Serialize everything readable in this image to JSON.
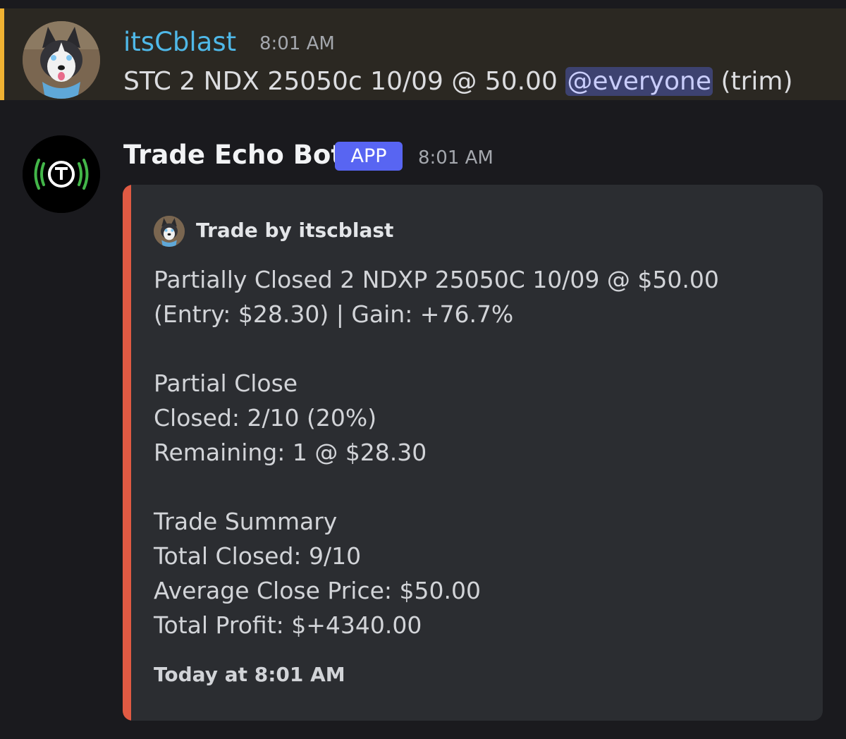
{
  "messages": [
    {
      "author": "itsCblast",
      "timestamp": "8:01 AM",
      "content_prefix": "STC 2 NDX 25050c 10/09 @ 50.00 ",
      "mention": "@everyone",
      "content_suffix": " (trim)",
      "avatar_icon": "husky-avatar-icon",
      "highlight_color": "#f0b232"
    },
    {
      "author": "Trade Echo Bot",
      "badge": "APP",
      "timestamp": "8:01 AM",
      "avatar_icon": "trade-echo-logo-icon",
      "embed": {
        "accent_color": "#e05a43",
        "author_name": "Trade by itscblast",
        "author_icon": "husky-avatar-icon",
        "lines": [
          "Partially Closed 2 NDXP 25050C 10/09 @ $50.00",
          "(Entry: $28.30) | Gain: +76.7%",
          "",
          "Partial Close",
          "Closed: 2/10 (20%)",
          "Remaining: 1 @ $28.30",
          "",
          "Trade Summary",
          "Total Closed: 9/10",
          "Average Close Price: $50.00",
          "Total Profit: $+4340.00"
        ],
        "footer": "Today at 8:01 AM"
      }
    }
  ]
}
